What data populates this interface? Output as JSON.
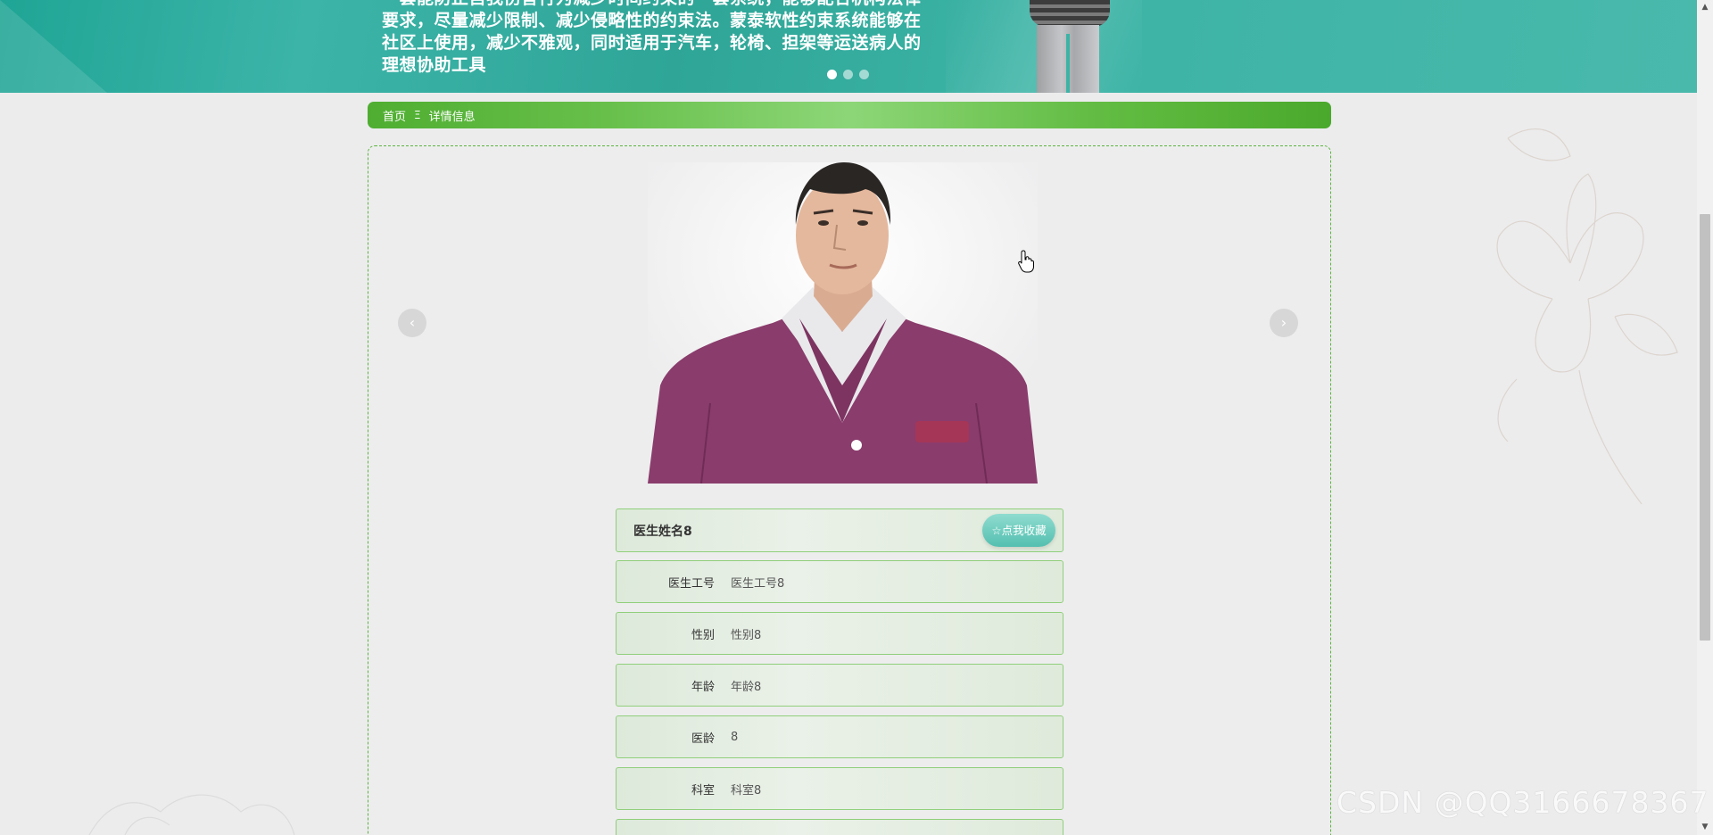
{
  "banner": {
    "text": "一套能防止自我伤害行为减少时间约束的一套系统，能够配合机构法律要求，尽量减少限制、减少侵略性的约束法。蒙泰软性约束系统能够在社区上使用，减少不雅观，同时适用于汽车，轮椅、担架等运送病人的理想协助工具",
    "slides_total": 3,
    "active_slide": 1
  },
  "breadcrumb": {
    "home": "首页",
    "separator": "Ξ",
    "current": "详情信息"
  },
  "detail": {
    "carousel_prev": "‹",
    "carousel_next": "›",
    "name": "医生姓名8",
    "favorite_label": "☆点我收藏",
    "fields": [
      {
        "label": "医生工号",
        "value": "医生工号8"
      },
      {
        "label": "性别",
        "value": "性别8"
      },
      {
        "label": "年龄",
        "value": "年龄8"
      },
      {
        "label": "医龄",
        "value": "8"
      },
      {
        "label": "科室",
        "value": "科室8"
      },
      {
        "label": "",
        "value": ""
      }
    ]
  },
  "watermark": "CSDN @QQ3166678367",
  "colors": {
    "banner_teal": "#3cb4a8",
    "breadcrumb_green": "#68c04b",
    "field_border": "#90cf7b",
    "favorite_button": "#54bfb0"
  },
  "icons": {
    "cursor": "hand-pointer-icon",
    "scroll_up": "triangle-up-icon",
    "scroll_down": "triangle-down-icon"
  }
}
